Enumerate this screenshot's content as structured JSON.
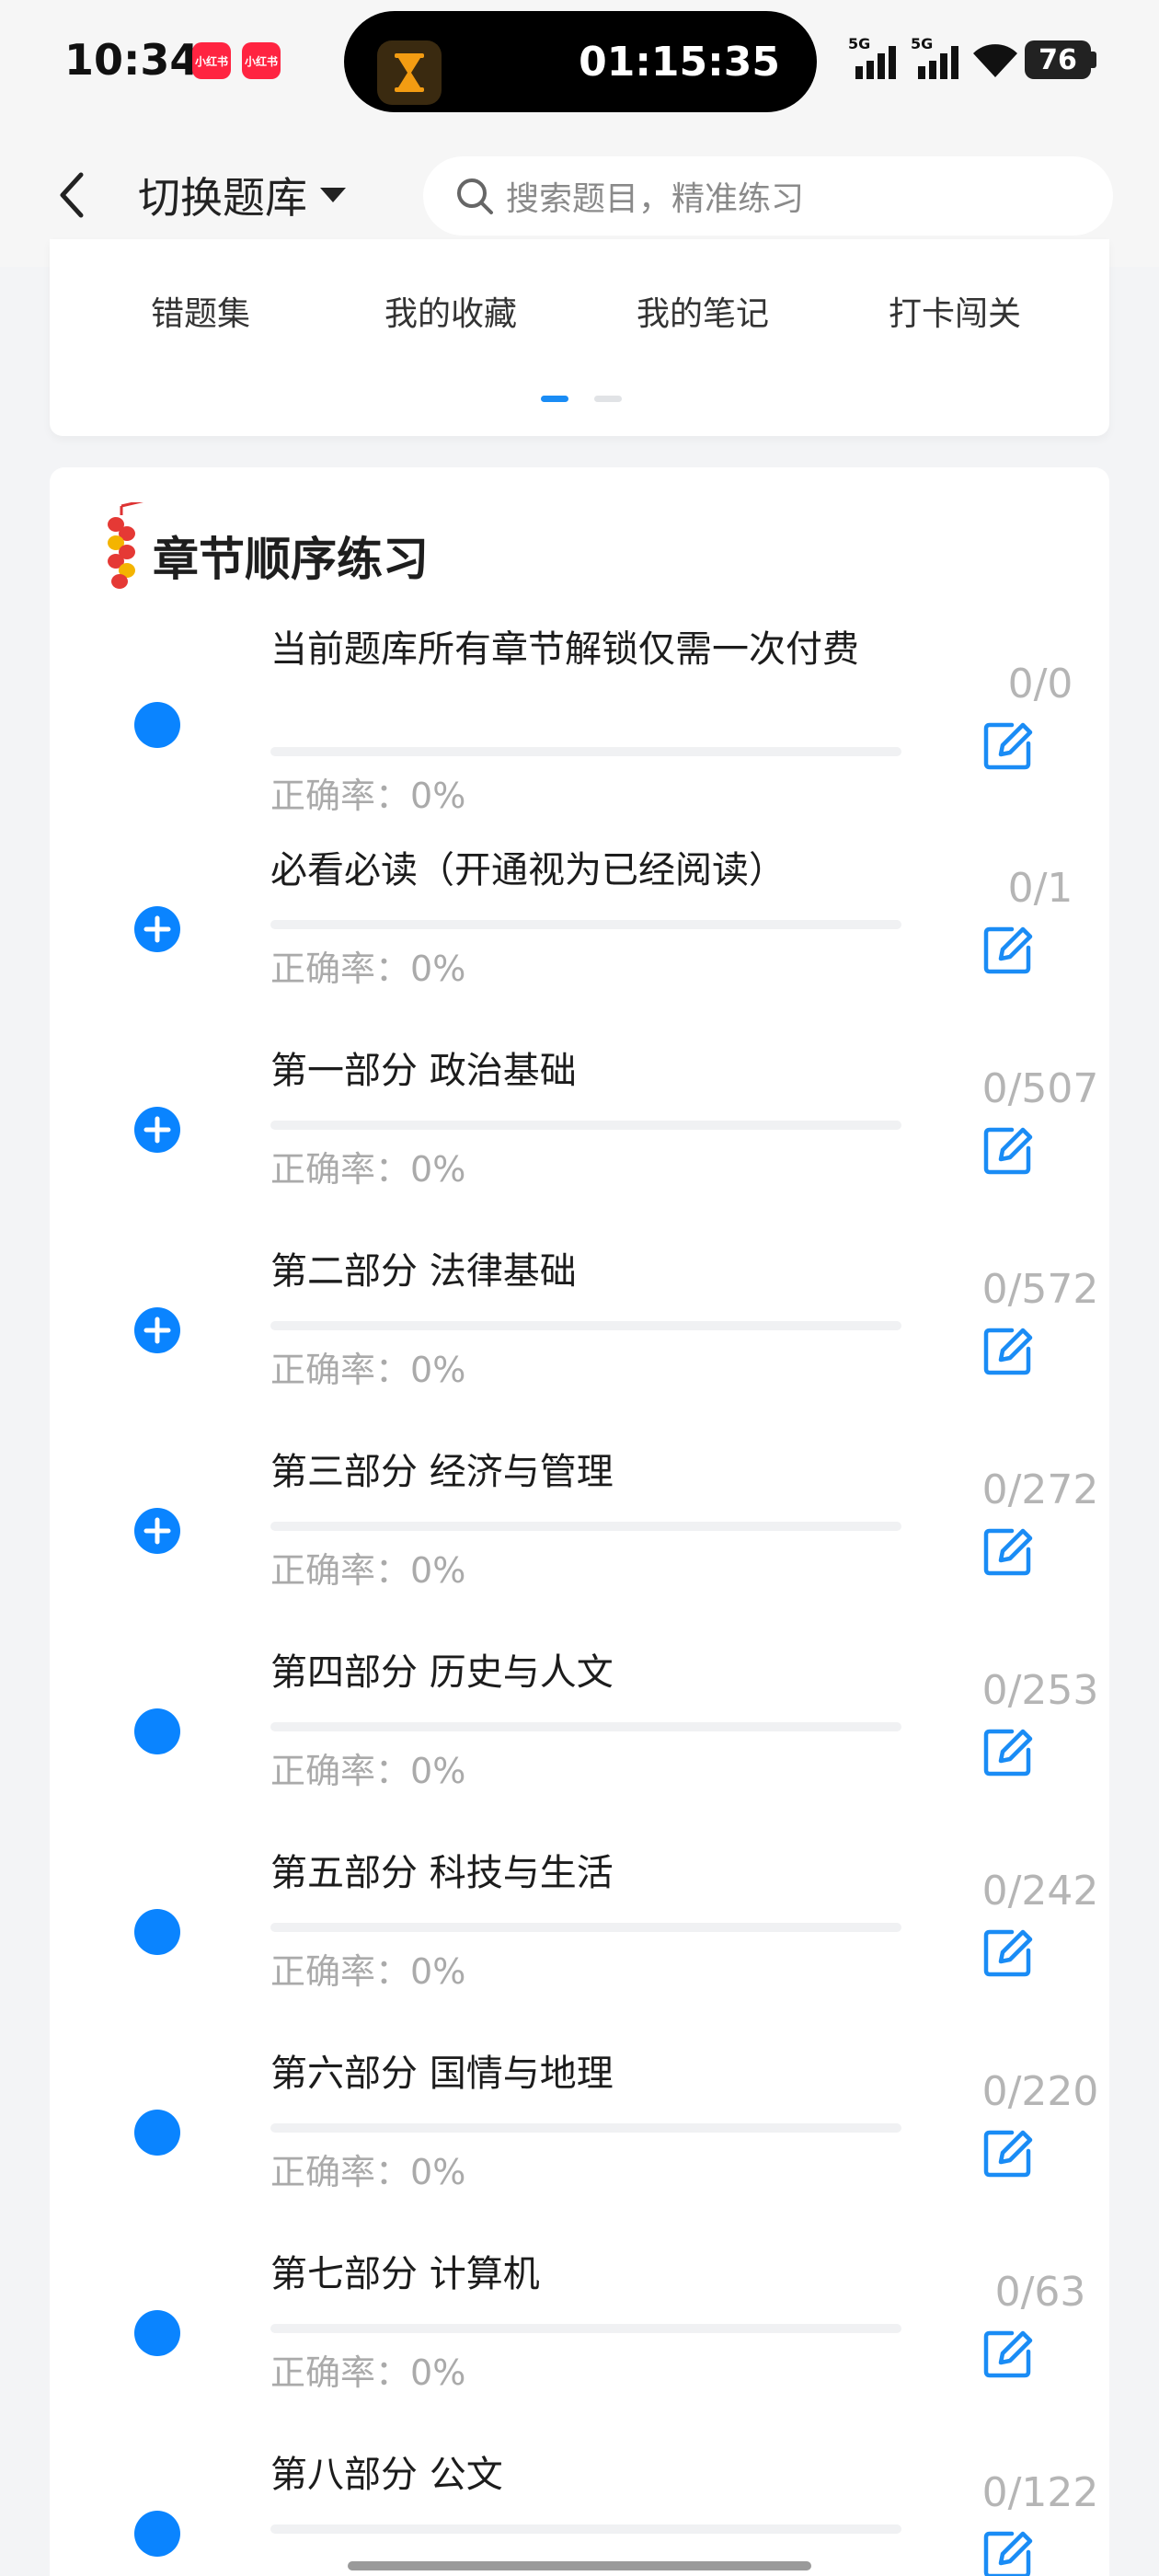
{
  "status_bar": {
    "time": "10:34",
    "app_badge_1": "小红书",
    "app_badge_2": "小红书",
    "timer": "01:15:35",
    "signal_1": "5G",
    "signal_2": "5G",
    "battery": "76"
  },
  "header": {
    "switch_label": "切换题库",
    "search_placeholder": "搜索题目，精准练习"
  },
  "shortcuts": {
    "items": [
      "错题集",
      "我的收藏",
      "我的笔记",
      "打卡闯关"
    ]
  },
  "section": {
    "title": "章节顺序练习",
    "rate_label": "正确率：",
    "chapters": [
      {
        "title": "当前题库所有章节解锁仅需一次付费",
        "rate": "0%",
        "count": "0/0",
        "expandable": false,
        "progress": 0
      },
      {
        "title": "必看必读（开通视为已经阅读）",
        "rate": "0%",
        "count": "0/1",
        "expandable": true,
        "progress": 0
      },
      {
        "title": "第一部分 政治基础",
        "rate": "0%",
        "count": "0/507",
        "expandable": true,
        "progress": 0
      },
      {
        "title": "第二部分 法律基础",
        "rate": "0%",
        "count": "0/572",
        "expandable": true,
        "progress": 0
      },
      {
        "title": "第三部分 经济与管理",
        "rate": "0%",
        "count": "0/272",
        "expandable": true,
        "progress": 0
      },
      {
        "title": "第四部分 历史与人文",
        "rate": "0%",
        "count": "0/253",
        "expandable": false,
        "progress": 0
      },
      {
        "title": "第五部分 科技与生活",
        "rate": "0%",
        "count": "0/242",
        "expandable": false,
        "progress": 0
      },
      {
        "title": "第六部分 国情与地理",
        "rate": "0%",
        "count": "0/220",
        "expandable": false,
        "progress": 0
      },
      {
        "title": "第七部分 计算机",
        "rate": "0%",
        "count": "0/63",
        "expandable": false,
        "progress": 0
      },
      {
        "title": "第八部分 公文",
        "rate": "",
        "count": "0/122",
        "expandable": false,
        "progress": 0
      }
    ]
  },
  "colors": {
    "accent": "#0a84ff",
    "muted": "#aaaaaa",
    "count": "#b5b5b5"
  }
}
